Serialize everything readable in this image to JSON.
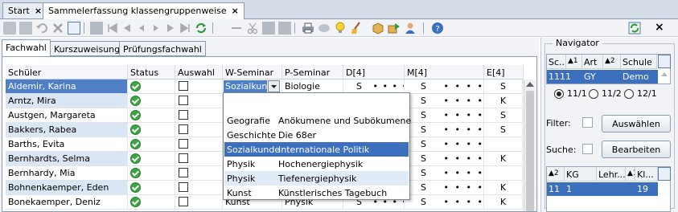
{
  "doc_tabs": [
    {
      "label": "Start",
      "close": "×"
    },
    {
      "label": "Sammelerfassung klassengruppenweise",
      "close": "×"
    }
  ],
  "window_close": "×",
  "sub_tabs": [
    "Fachwahl",
    "Kurszuweisung",
    "Prüfungsfachwahl"
  ],
  "grid": {
    "columns": [
      "Schüler",
      "Status",
      "Auswahl",
      "W-Seminar",
      "P-Seminar",
      "D[4]",
      "M[4]",
      "E[4]"
    ],
    "rows": [
      {
        "name": "Aldemir, Karina",
        "w": "Sozialkunde",
        "p": "Biologie",
        "d": "S",
        "d_dots": "• • • •",
        "m": "S",
        "m_dots": "• • • •",
        "e": "S"
      },
      {
        "name": "Arntz, Mira",
        "w": "",
        "p": "",
        "d": "",
        "d_dots": "",
        "m": "S",
        "m_dots": "• • • •",
        "e": "K"
      },
      {
        "name": "Austgen, Margareta",
        "w": "",
        "p": "",
        "d": "",
        "d_dots": "",
        "m": "S",
        "m_dots": "• • • •",
        "e": "S"
      },
      {
        "name": "Bakkers, Rabea",
        "w": "",
        "p": "",
        "d": "",
        "d_dots": "",
        "m": "S",
        "m_dots": "• • • •",
        "e": "S"
      },
      {
        "name": "Barths, Evita",
        "w": "",
        "p": "",
        "d": "",
        "d_dots": "",
        "m": "S",
        "m_dots": "• • • •",
        "e": ""
      },
      {
        "name": "Bernhardts, Selma",
        "w": "",
        "p": "",
        "d": "",
        "d_dots": "",
        "m": "S",
        "m_dots": "• • • •",
        "e": "K"
      },
      {
        "name": "Bernhardy, Mia",
        "w": "",
        "p": "",
        "d": "",
        "d_dots": "",
        "m": "S",
        "m_dots": "• • • •",
        "e": ""
      },
      {
        "name": "Bohnenkaemper, Eden",
        "w": "",
        "p": "",
        "d": "",
        "d_dots": "",
        "m": "S",
        "m_dots": "• • • •",
        "e": "K"
      },
      {
        "name": "Bonekaemper, Deniz",
        "w": "Kunst",
        "p": "Physik",
        "d": "S",
        "d_dots": "• • • •",
        "m": "S",
        "m_dots": "• • • •",
        "e": "K"
      }
    ]
  },
  "dropdown": {
    "current": "Sozialkunde",
    "items": [
      {
        "subject": "",
        "topic": ""
      },
      {
        "subject": "Geografie",
        "topic": "Anökumene und Subökumene"
      },
      {
        "subject": "Geschichte",
        "topic": "Die 68er"
      },
      {
        "subject": "Sozialkunde",
        "topic": "Internationale Politik"
      },
      {
        "subject": "Physik",
        "topic": "Hochenergiephysik"
      },
      {
        "subject": "Physik",
        "topic": "Tiefenergiephysik"
      },
      {
        "subject": "Kunst",
        "topic": "Künstlerisches Tagebuch"
      }
    ]
  },
  "navigator": {
    "title": "Navigator",
    "grid1": {
      "headers": [
        "Sc...",
        "▲1",
        "Art",
        "▲2",
        "Schule"
      ],
      "row": [
        "1111",
        "GY",
        "Demo"
      ]
    },
    "radios": [
      "11/1",
      "11/2",
      "12/1"
    ],
    "filter_label": "Filter:",
    "filter_button": "Auswählen",
    "search_label": "Suche:",
    "search_button": "Bearbeiten",
    "grid2": {
      "headers": [
        "▲2",
        "KG",
        "Lehr...",
        "▲1",
        "Kl..."
      ],
      "row": [
        "11",
        "1",
        "19"
      ]
    }
  }
}
